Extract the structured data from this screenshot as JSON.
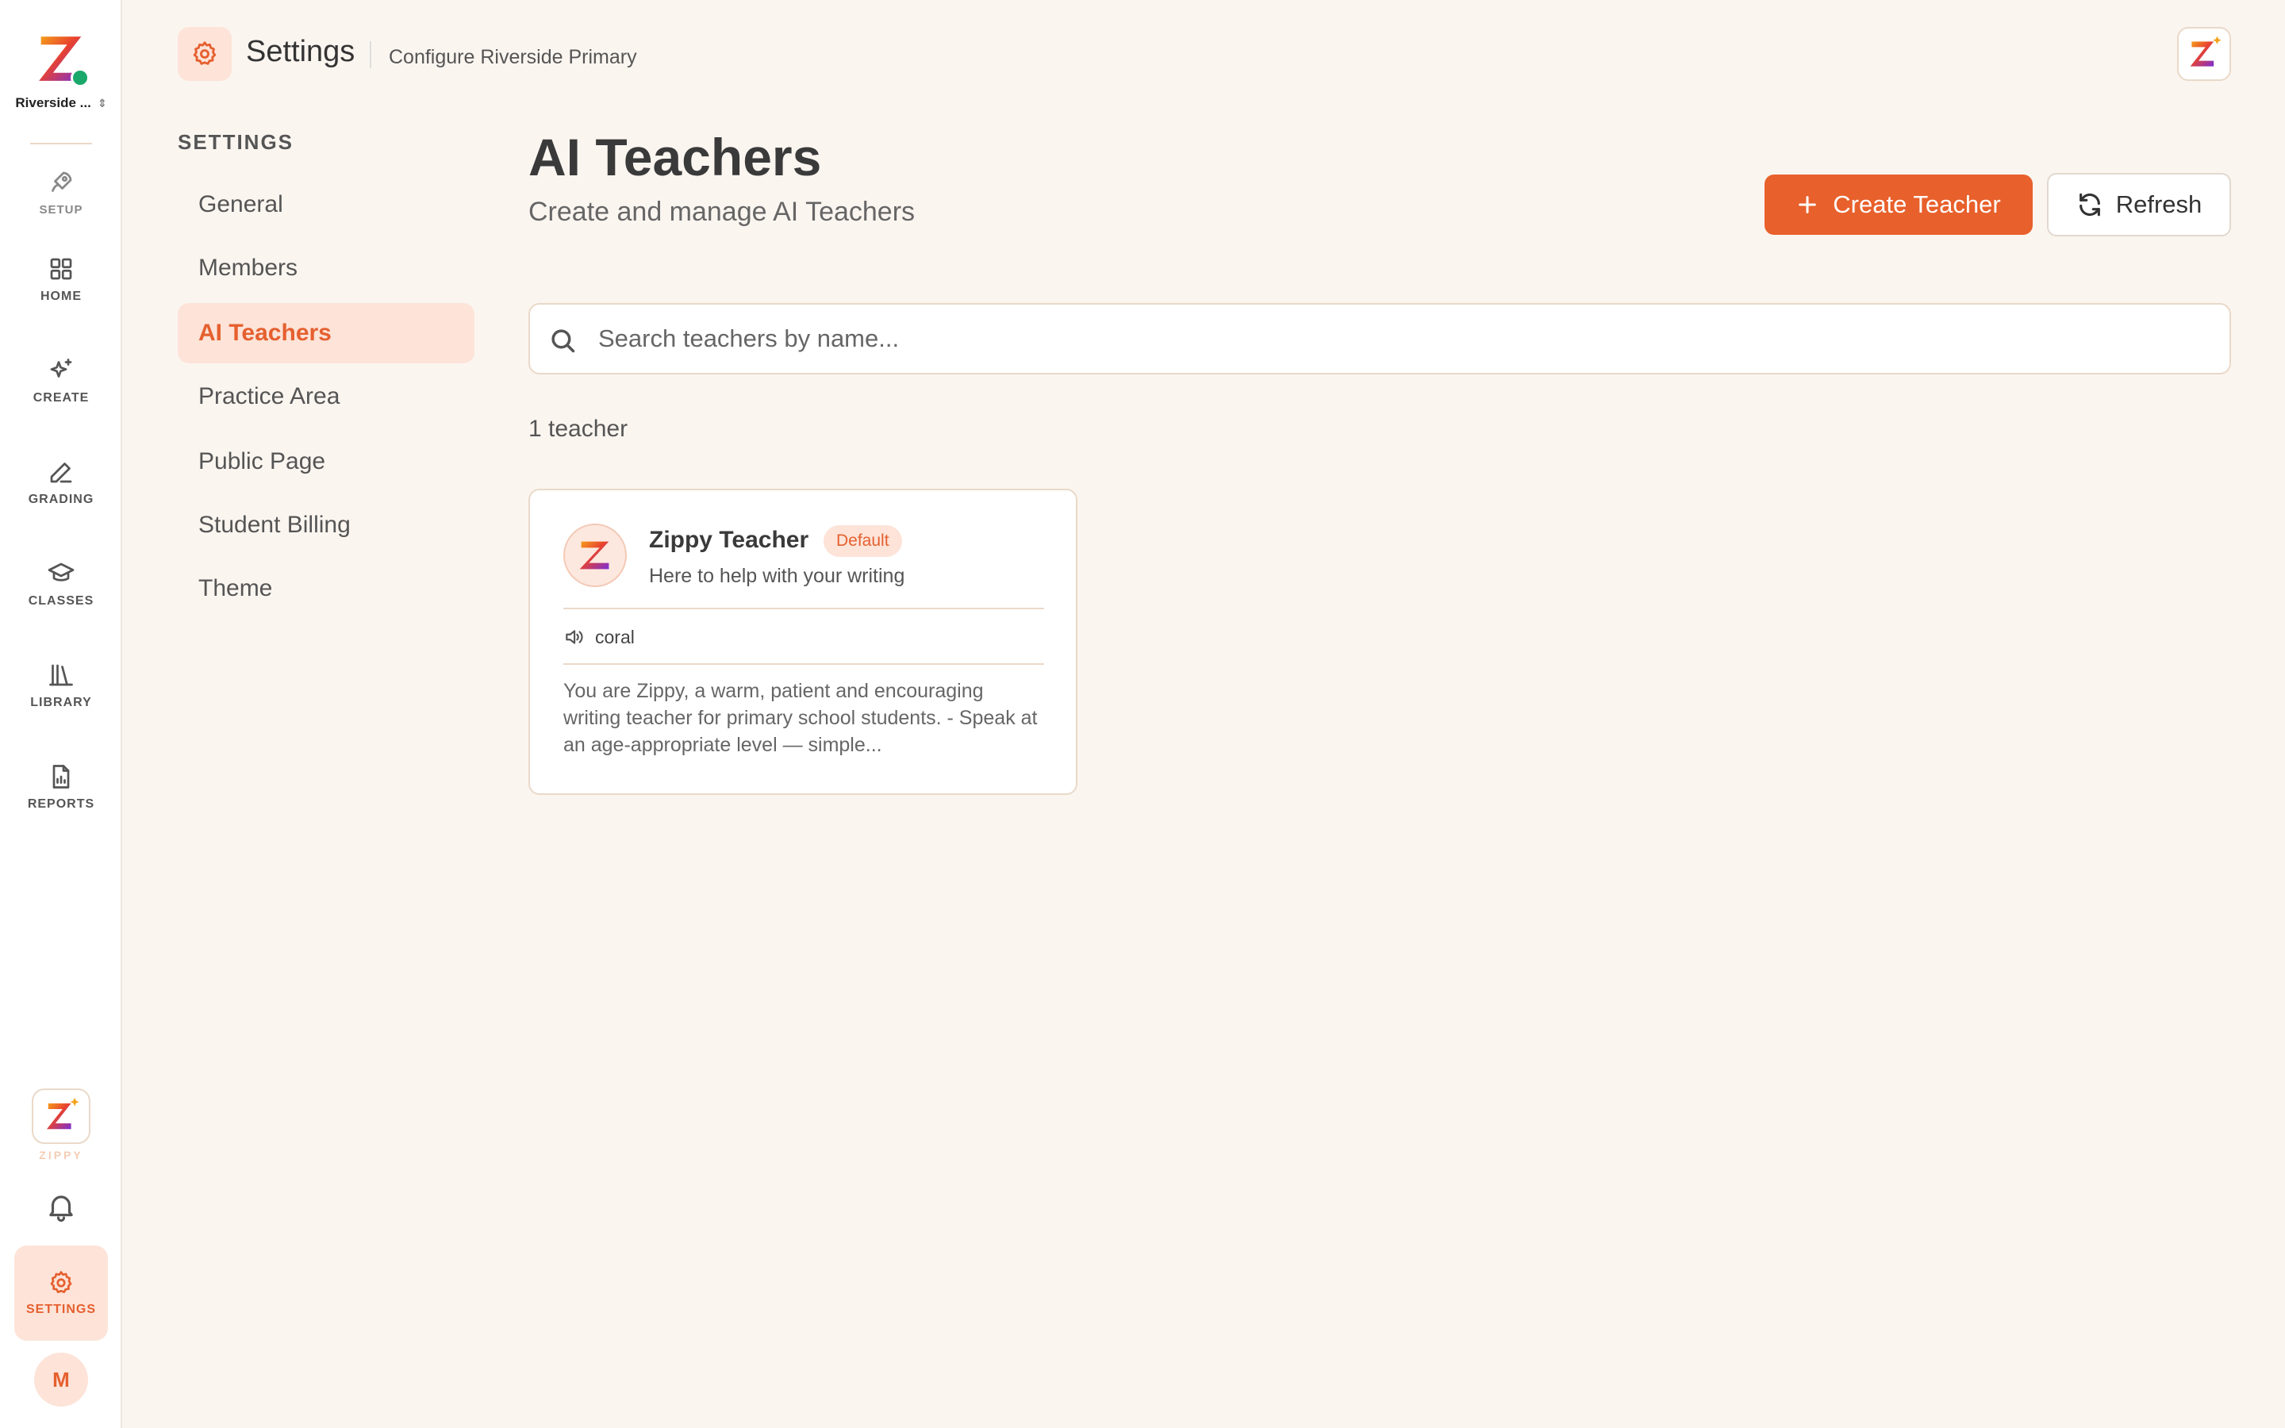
{
  "rail": {
    "org_name": "Riverside ...",
    "items": [
      {
        "label": "SETUP",
        "icon": "rocket-icon"
      },
      {
        "label": "HOME",
        "icon": "grid-icon"
      },
      {
        "label": "CREATE",
        "icon": "sparkles-icon"
      },
      {
        "label": "GRADING",
        "icon": "pen-icon"
      },
      {
        "label": "CLASSES",
        "icon": "graduation-cap-icon"
      },
      {
        "label": "LIBRARY",
        "icon": "books-icon"
      },
      {
        "label": "REPORTS",
        "icon": "report-icon"
      }
    ],
    "zippy_label": "ZIPPY",
    "settings_label": "SETTINGS",
    "avatar_initial": "M"
  },
  "header": {
    "title": "Settings",
    "subtitle": "Configure Riverside Primary"
  },
  "settings_nav": {
    "heading": "SETTINGS",
    "items": [
      {
        "label": "General"
      },
      {
        "label": "Members"
      },
      {
        "label": "AI Teachers",
        "active": true
      },
      {
        "label": "Practice Area"
      },
      {
        "label": "Public Page"
      },
      {
        "label": "Student Billing"
      },
      {
        "label": "Theme"
      }
    ]
  },
  "main": {
    "title": "AI Teachers",
    "subtitle": "Create and manage AI Teachers",
    "create_button": "Create Teacher",
    "refresh_button": "Refresh",
    "search": {
      "placeholder": "Search teachers by name...",
      "value": ""
    },
    "count_text": "1 teacher",
    "teachers": [
      {
        "name": "Zippy Teacher",
        "badge": "Default",
        "tagline": "Here to help with your writing",
        "voice": "coral",
        "prompt_preview": "You are Zippy, a warm, patient and encouraging writing teacher for primary school students. - Speak at an age-appropriate level — simple..."
      }
    ]
  },
  "colors": {
    "accent": "#e8602b",
    "accent_soft": "#fde3d8",
    "background": "#fbf5f0",
    "online": "#1aa86b"
  }
}
